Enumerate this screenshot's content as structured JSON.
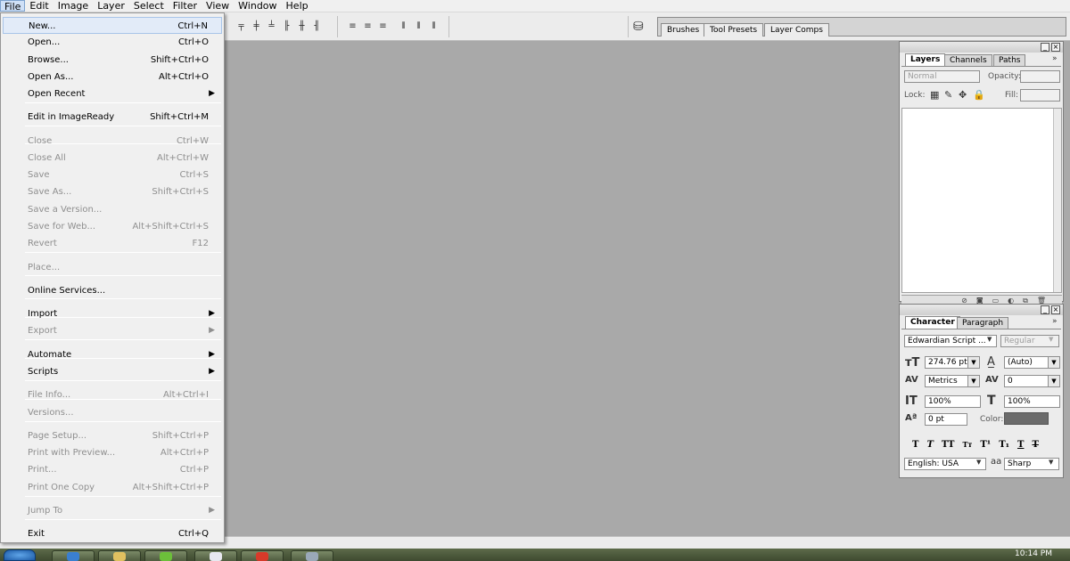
{
  "menubar": {
    "items": [
      "File",
      "Edit",
      "Image",
      "Layer",
      "Select",
      "Filter",
      "View",
      "Window",
      "Help"
    ]
  },
  "file_menu": {
    "items": [
      {
        "label": "New...",
        "shortcut": "Ctrl+N",
        "disabled": false,
        "highlighted": true
      },
      {
        "label": "Open...",
        "shortcut": "Ctrl+O",
        "disabled": false
      },
      {
        "label": "Browse...",
        "shortcut": "Shift+Ctrl+O",
        "disabled": false
      },
      {
        "label": "Open As...",
        "shortcut": "Alt+Ctrl+O",
        "disabled": false
      },
      {
        "label": "Open Recent",
        "shortcut": "",
        "disabled": false,
        "submenu": true
      },
      {
        "label": "Edit in ImageReady",
        "shortcut": "Shift+Ctrl+M",
        "disabled": false
      },
      {
        "label": "Close",
        "shortcut": "Ctrl+W",
        "disabled": true
      },
      {
        "label": "Close All",
        "shortcut": "Alt+Ctrl+W",
        "disabled": true
      },
      {
        "label": "Save",
        "shortcut": "Ctrl+S",
        "disabled": true
      },
      {
        "label": "Save As...",
        "shortcut": "Shift+Ctrl+S",
        "disabled": true
      },
      {
        "label": "Save a Version...",
        "shortcut": "",
        "disabled": true
      },
      {
        "label": "Save for Web...",
        "shortcut": "Alt+Shift+Ctrl+S",
        "disabled": true
      },
      {
        "label": "Revert",
        "shortcut": "F12",
        "disabled": true
      },
      {
        "label": "Place...",
        "shortcut": "",
        "disabled": true
      },
      {
        "label": "Online Services...",
        "shortcut": "",
        "disabled": false
      },
      {
        "label": "Import",
        "shortcut": "",
        "disabled": false,
        "submenu": true
      },
      {
        "label": "Export",
        "shortcut": "",
        "disabled": true,
        "submenu": true
      },
      {
        "label": "Automate",
        "shortcut": "",
        "disabled": false,
        "submenu": true
      },
      {
        "label": "Scripts",
        "shortcut": "",
        "disabled": false,
        "submenu": true
      },
      {
        "label": "File Info...",
        "shortcut": "Alt+Ctrl+I",
        "disabled": true
      },
      {
        "label": "Versions...",
        "shortcut": "",
        "disabled": true
      },
      {
        "label": "Page Setup...",
        "shortcut": "Shift+Ctrl+P",
        "disabled": true
      },
      {
        "label": "Print with Preview...",
        "shortcut": "Alt+Ctrl+P",
        "disabled": true
      },
      {
        "label": "Print...",
        "shortcut": "Ctrl+P",
        "disabled": true
      },
      {
        "label": "Print One Copy",
        "shortcut": "Alt+Shift+Ctrl+P",
        "disabled": true
      },
      {
        "label": "Jump To",
        "shortcut": "",
        "disabled": true,
        "submenu": true
      },
      {
        "label": "Exit",
        "shortcut": "Ctrl+Q",
        "disabled": false
      }
    ]
  },
  "palette_well": {
    "tabs": [
      "Brushes",
      "Tool Presets",
      "Layer Comps"
    ]
  },
  "layers_panel": {
    "tabs": [
      "Layers",
      "Channels",
      "Paths"
    ],
    "blend_mode": "Normal",
    "opacity_label": "Opacity:",
    "lock_label": "Lock:",
    "fill_label": "Fill:"
  },
  "character_panel": {
    "tabs": [
      "Character",
      "Paragraph"
    ],
    "font_family": "Edwardian Script ...",
    "font_style": "Regular",
    "font_size": "274.76 pt",
    "leading": "(Auto)",
    "kerning": "Metrics",
    "tracking": "0",
    "vertical_scale": "100%",
    "horizontal_scale": "100%",
    "baseline_shift": "0 pt",
    "color_label": "Color:",
    "text_color": "#6b6b6b",
    "language": "English: USA",
    "antialias_icon": "aa",
    "antialias": "Sharp"
  },
  "taskbar": {
    "time": "10:14 PM"
  }
}
